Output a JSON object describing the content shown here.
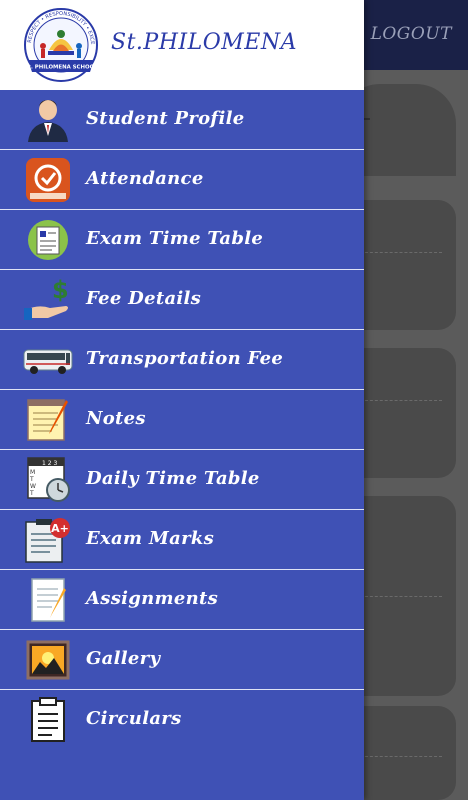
{
  "app": {
    "school_name": "St.PHILOMENA",
    "logo": {
      "icon": "school-logo-icon",
      "ring_text": "RESPECT • RESPONSIBILITY • EXCELLENCE",
      "banner_text": "St. PHILOMENA SCHOOL"
    }
  },
  "topbar": {
    "logout_label": "LOGOUT"
  },
  "menu": {
    "items": [
      {
        "label": "Student Profile",
        "icon": "student-profile-icon"
      },
      {
        "label": "Attendance",
        "icon": "attendance-icon"
      },
      {
        "label": "Exam Time Table",
        "icon": "exam-time-table-icon"
      },
      {
        "label": "Fee Details",
        "icon": "fee-details-icon"
      },
      {
        "label": "Transportation Fee",
        "icon": "bus-icon"
      },
      {
        "label": "Notes",
        "icon": "notes-icon"
      },
      {
        "label": "Daily Time Table",
        "icon": "daily-time-table-icon"
      },
      {
        "label": "Exam Marks",
        "icon": "exam-marks-icon"
      },
      {
        "label": "Assignments",
        "icon": "assignments-icon"
      },
      {
        "label": "Gallery",
        "icon": "gallery-icon"
      },
      {
        "label": "Circulars",
        "icon": "circulars-icon"
      }
    ]
  },
  "colors": {
    "drawer_bg": "#3f51b5",
    "header_bg": "#ffffff",
    "school_name": "#2a3aa8",
    "topbar": "#1a2147",
    "overlay": "#5b5b5b"
  }
}
